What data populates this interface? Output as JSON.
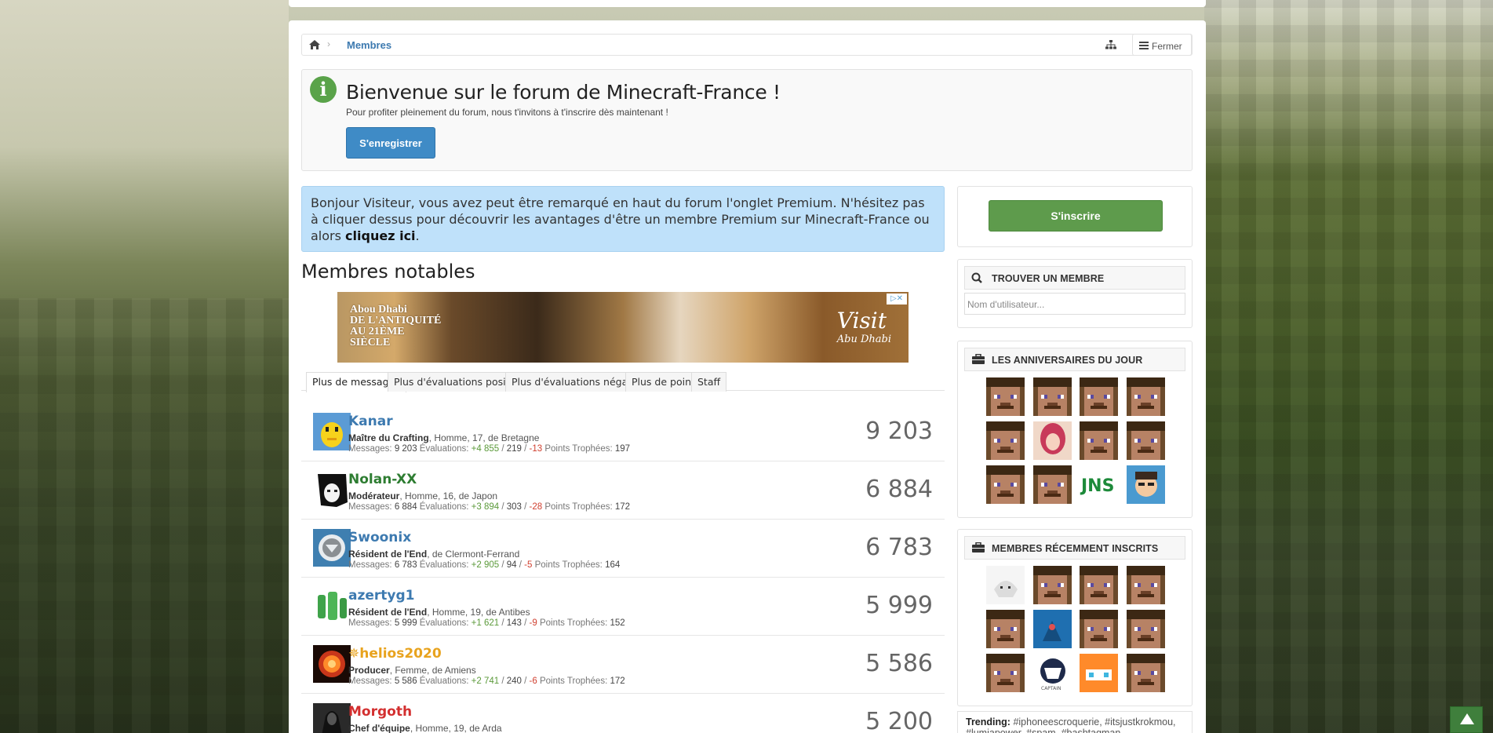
{
  "breadcrumb": {
    "home_icon": "home-icon",
    "current": "Membres",
    "close_label": "Fermer"
  },
  "welcome": {
    "title": "Bienvenue sur le forum de Minecraft-France !",
    "text": "Pour profiter pleinement du forum, nous t'invitons à t'inscrire dès maintenant !",
    "button": "S'enregistrer"
  },
  "premium": {
    "text": "Bonjour Visiteur, vous avez peut être remarqué en haut du forum l'onglet Premium. N'hésitez pas à cliquer dessus pour découvrir les avantages d'être un membre Premium sur Minecraft-France ou alors ",
    "link": "cliquez ici",
    "end": "."
  },
  "notable_title": "Membres notables",
  "ad": {
    "left": "Abou Dhabi\nDE L'ANTIQUITÉ\nAU 21ÈME\nSIÈCLE",
    "right_big": "Visit",
    "right_small": "Abu Dhabi"
  },
  "tabs": [
    "Plus de messages",
    "Plus d'évaluations positives",
    "Plus d'évaluations négatives",
    "Plus de points",
    "Staff"
  ],
  "members": [
    {
      "name": "Kanar",
      "color": "#3d7ab0",
      "title": "Maître du Crafting",
      "info": ", Homme, 17, de Bretagne",
      "messages": "9 203",
      "pos": "+4 855",
      "mid": "219",
      "neg": "-13",
      "trophies": "197",
      "count": "9 203"
    },
    {
      "name": "Nolan-XX",
      "color": "#2e7d32",
      "title": "Modérateur",
      "info": ", Homme, 16, de Japon",
      "messages": "6 884",
      "pos": "+3 894",
      "mid": "303",
      "neg": "-28",
      "trophies": "172",
      "count": "6 884"
    },
    {
      "name": "Swoonix",
      "color": "#3d7ab0",
      "title": "Résident de l'End",
      "info": ", de Clermont-Ferrand",
      "messages": "6 783",
      "pos": "+2 905",
      "mid": "94",
      "neg": "-5",
      "trophies": "164",
      "count": "6 783"
    },
    {
      "name": "azertyg1",
      "color": "#3d7ab0",
      "title": "Résident de l'End",
      "info": ", Homme, 19, de Antibes",
      "messages": "5 999",
      "pos": "+1 621",
      "mid": "143",
      "neg": "-9",
      "trophies": "152",
      "count": "5 999"
    },
    {
      "name": "✵helios2020",
      "color": "#e8a31e",
      "title": "Producer",
      "info": ", Femme, de Amiens",
      "messages": "5 586",
      "pos": "+2 741",
      "mid": "240",
      "neg": "-6",
      "trophies": "172",
      "count": "5 586"
    },
    {
      "name": "Morgoth",
      "color": "#d32f2f",
      "title": "Chef d'équipe",
      "info": ", Homme, 19, de Arda",
      "messages": "",
      "pos": "",
      "mid": "",
      "neg": "",
      "trophies": "",
      "count": "5 200"
    }
  ],
  "labels": {
    "messages": "Messages:",
    "evaluations": "Évaluations:",
    "trophies": "Points Trophées:"
  },
  "sidebar": {
    "signup": "S'inscrire",
    "find_member": {
      "title": "TROUVER UN MEMBRE",
      "placeholder": "Nom d'utilisateur..."
    },
    "birthdays": {
      "title": "LES ANNIVERSAIRES DU JOUR"
    },
    "recent": {
      "title": "MEMBRES RÉCEMMENT INSCRITS"
    },
    "trending_label": "Trending:",
    "trending_tags": "#iphoneescroquerie, #itsjustkrokmou, #lumiapower, #spam, #bashtagman"
  }
}
